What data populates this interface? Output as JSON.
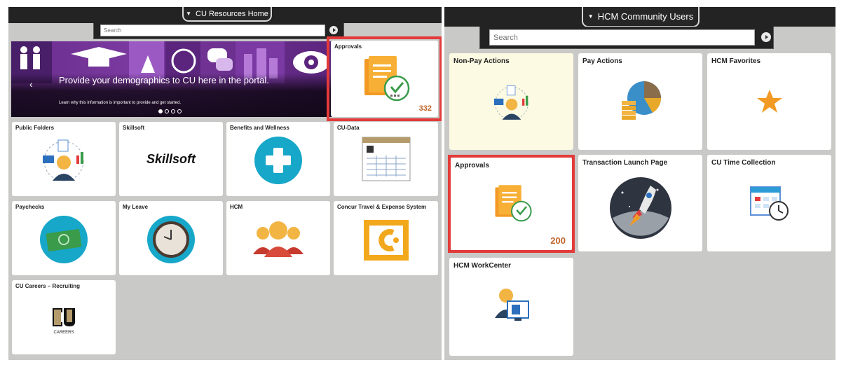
{
  "left": {
    "homepage_title": "CU Resources Home",
    "search_placeholder": "Search",
    "carousel": {
      "headline": "Provide your demographics to CU here in the portal.",
      "subtext": "Learn why this information is important to provide and get started."
    },
    "tiles": {
      "approvals": {
        "title": "Approvals",
        "count": "332"
      },
      "public_folders": {
        "title": "Public Folders"
      },
      "skillsoft": {
        "title": "Skillsoft",
        "logo_text": "Skillsoft"
      },
      "benefits": {
        "title": "Benefits and Wellness"
      },
      "cu_data": {
        "title": "CU-Data"
      },
      "paychecks": {
        "title": "Paychecks"
      },
      "my_leave": {
        "title": "My Leave"
      },
      "hcm": {
        "title": "HCM"
      },
      "concur": {
        "title": "Concur Travel & Expense System"
      },
      "cu_careers": {
        "title": "CU Careers – Recruiting",
        "logo_text": "CAREERS"
      }
    }
  },
  "right": {
    "homepage_title": "HCM Community Users",
    "search_placeholder": "Search",
    "tiles": {
      "non_pay": {
        "title": "Non-Pay Actions"
      },
      "pay_actions": {
        "title": "Pay Actions"
      },
      "hcm_favorites": {
        "title": "HCM Favorites"
      },
      "approvals": {
        "title": "Approvals",
        "count": "200"
      },
      "transaction_launch": {
        "title": "Transaction Launch Page"
      },
      "cu_time": {
        "title": "CU Time Collection"
      },
      "hcm_workcenter": {
        "title": "HCM WorkCenter"
      }
    }
  },
  "colors": {
    "highlight": "#e33a3a",
    "count": "#c0662a",
    "topbar": "#232323",
    "panel_bg": "#c9c9c7"
  }
}
